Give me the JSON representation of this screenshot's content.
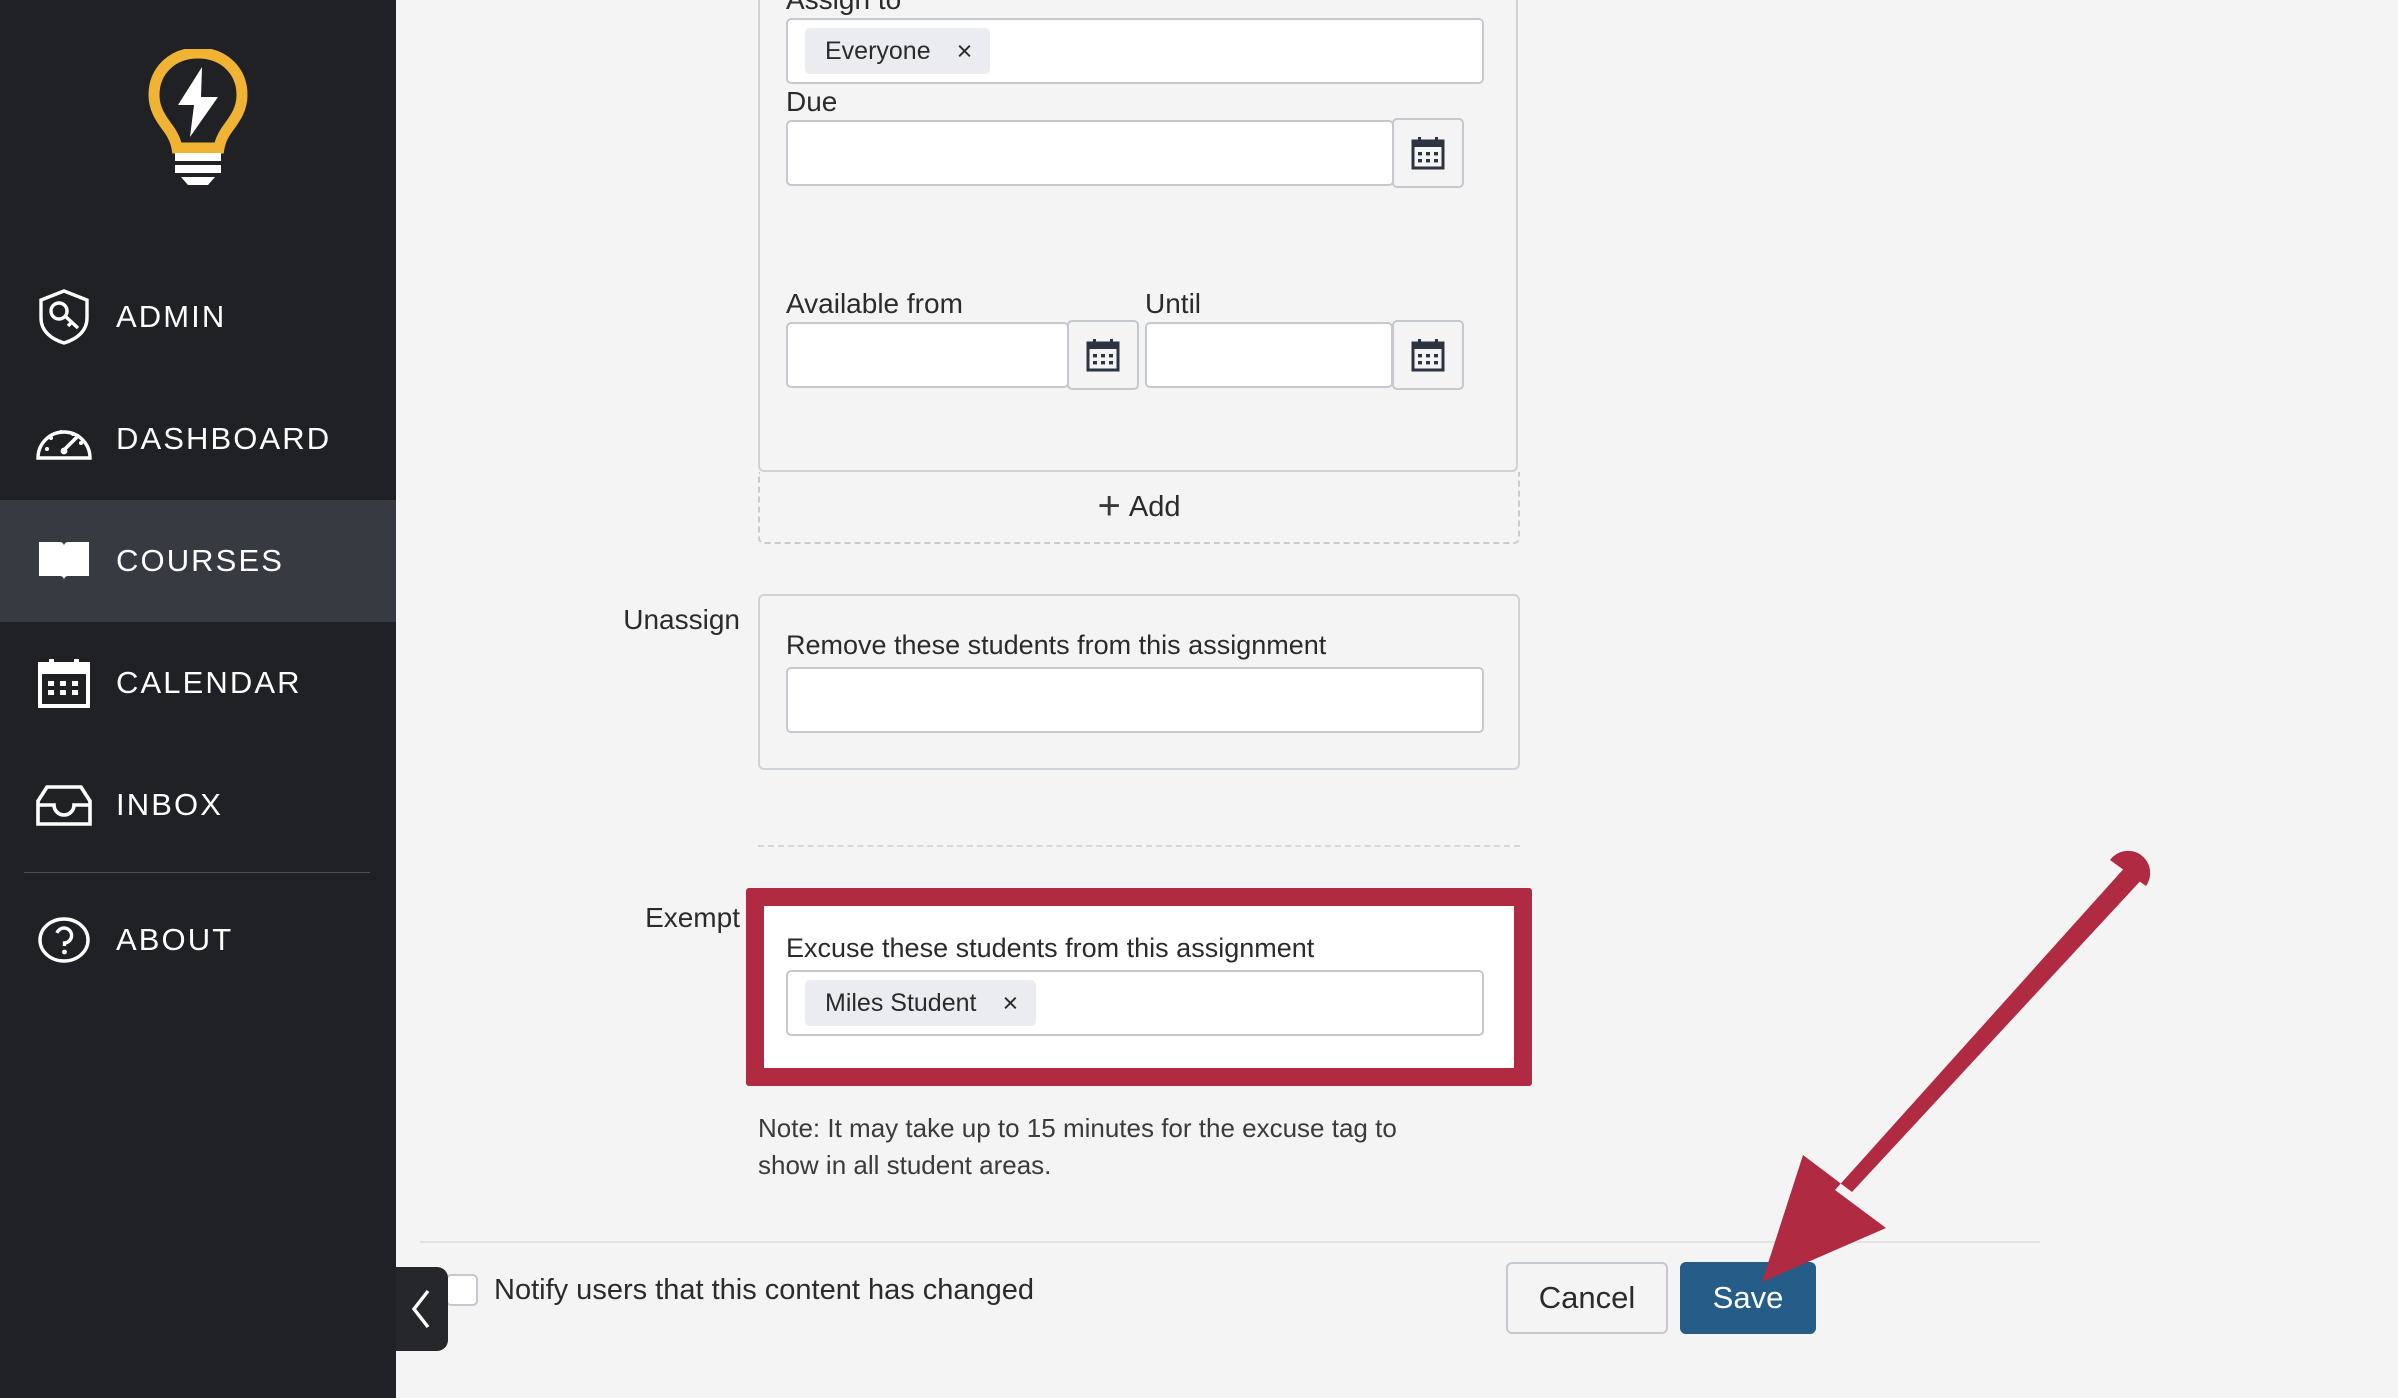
{
  "sidebar": {
    "logo_name": "lightbulb-logo",
    "items": [
      {
        "label": "ADMIN",
        "icon": "shield-key-icon",
        "active": false
      },
      {
        "label": "DASHBOARD",
        "icon": "speedometer-icon",
        "active": false
      },
      {
        "label": "COURSES",
        "icon": "book-icon",
        "active": true
      },
      {
        "label": "CALENDAR",
        "icon": "calendar-icon",
        "active": false
      },
      {
        "label": "INBOX",
        "icon": "inbox-icon",
        "active": false
      },
      {
        "label": "ABOUT",
        "icon": "question-circle-icon",
        "active": false
      }
    ],
    "collapse_label": "collapse-sidebar"
  },
  "form": {
    "assign_to": {
      "label": "Assign to",
      "tags": [
        {
          "label": "Everyone",
          "remove": "×"
        }
      ],
      "input_value": ""
    },
    "due": {
      "label": "Due",
      "value": "",
      "calendar_icon": "calendar-icon"
    },
    "available_from": {
      "label": "Available from",
      "value": "",
      "calendar_icon": "calendar-icon"
    },
    "until": {
      "label": "Until",
      "value": "",
      "calendar_icon": "calendar-icon"
    },
    "add_button": {
      "plus": "+",
      "label": "Add"
    },
    "unassign": {
      "section_label": "Unassign",
      "description": "Remove these students from this assignment",
      "value": "",
      "tags": []
    },
    "exempt": {
      "section_label": "Exempt",
      "description": "Excuse these students from this assignment",
      "tags": [
        {
          "label": "Miles Student",
          "remove": "×"
        }
      ],
      "value": "",
      "note": "Note: It may take up to 15 minutes for the excuse tag to show in all student areas.",
      "highlight_color": "#b02a42"
    }
  },
  "footer": {
    "notify_label": "Notify users that this content has changed",
    "notify_checked": false,
    "cancel_label": "Cancel",
    "save_label": "Save",
    "save_color": "#255c88"
  },
  "annotation": {
    "arrow_color": "#b02a42",
    "arrow_name": "pointer-arrow-to-save-button"
  }
}
